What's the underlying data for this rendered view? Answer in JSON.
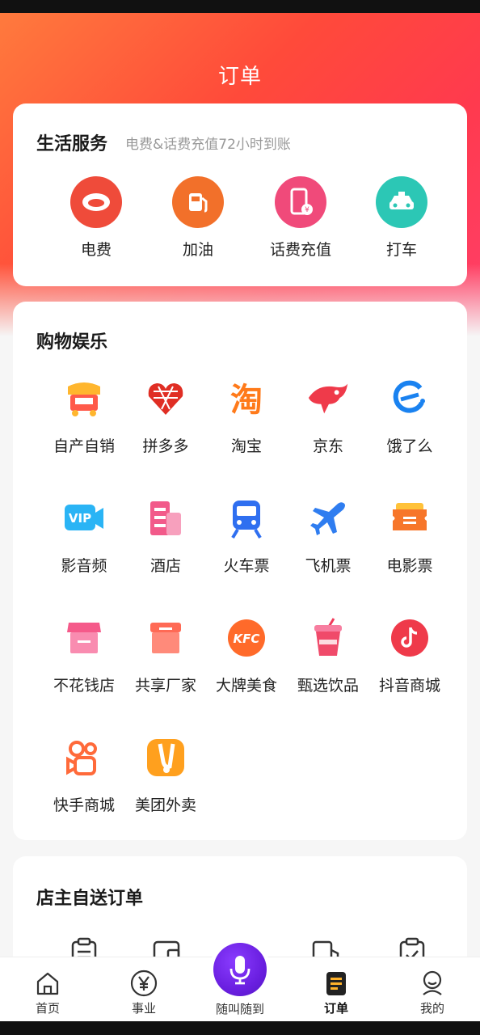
{
  "header": {
    "title": "订单"
  },
  "life_services": {
    "title": "生活服务",
    "subtitle": "电费&话费充值72小时到账",
    "items": [
      {
        "label": "电费",
        "icon": "electricity-icon",
        "color": "#ef4b3a"
      },
      {
        "label": "加油",
        "icon": "fuel-pump-icon",
        "color": "#f2702a"
      },
      {
        "label": "话费充值",
        "icon": "phone-recharge-icon",
        "color": "#f04a7a"
      },
      {
        "label": "打车",
        "icon": "taxi-icon",
        "color": "#2cc7b5"
      }
    ]
  },
  "shopping": {
    "title": "购物娱乐",
    "items": [
      {
        "label": "自产自销",
        "icon": "market-stall-icon"
      },
      {
        "label": "拼多多",
        "icon": "pinduoduo-icon"
      },
      {
        "label": "淘宝",
        "icon": "taobao-icon"
      },
      {
        "label": "京东",
        "icon": "jd-icon"
      },
      {
        "label": "饿了么",
        "icon": "eleme-icon"
      },
      {
        "label": "影音频",
        "icon": "vip-video-icon"
      },
      {
        "label": "酒店",
        "icon": "hotel-icon"
      },
      {
        "label": "火车票",
        "icon": "train-icon"
      },
      {
        "label": "飞机票",
        "icon": "airplane-icon"
      },
      {
        "label": "电影票",
        "icon": "movie-ticket-icon"
      },
      {
        "label": "不花钱店",
        "icon": "free-shop-icon"
      },
      {
        "label": "共享厂家",
        "icon": "shared-factory-icon"
      },
      {
        "label": "大牌美食",
        "icon": "kfc-icon"
      },
      {
        "label": "甄选饮品",
        "icon": "drink-cup-icon"
      },
      {
        "label": "抖音商城",
        "icon": "douyin-icon"
      },
      {
        "label": "快手商城",
        "icon": "kuaishou-icon"
      },
      {
        "label": "美团外卖",
        "icon": "meituan-icon"
      }
    ]
  },
  "owner_orders": {
    "title": "店主自送订单"
  },
  "tabbar": {
    "items": [
      {
        "label": "首页",
        "icon": "home-icon"
      },
      {
        "label": "事业",
        "icon": "yuan-icon"
      },
      {
        "label": "随叫随到",
        "icon": "microphone-icon"
      },
      {
        "label": "订单",
        "icon": "order-icon",
        "active": true
      },
      {
        "label": "我的",
        "icon": "profile-icon"
      }
    ]
  }
}
